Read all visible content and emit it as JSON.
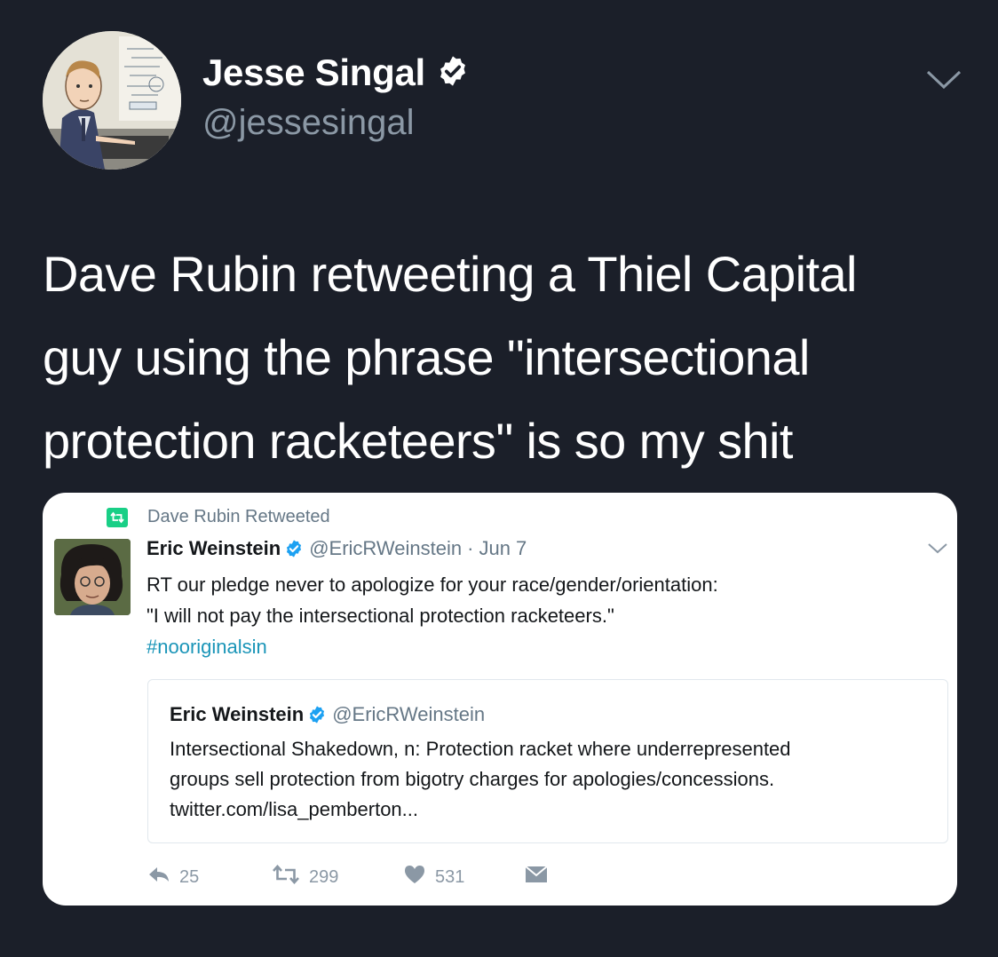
{
  "header": {
    "name": "Jesse Singal",
    "handle": "@jessesingal",
    "avatar_icon": "cartoon-avatar",
    "verified_icon": "verified-badge-icon",
    "menu_icon": "chevron-down-icon"
  },
  "tweet": {
    "lines": [
      "Dave Rubin retweeting a Thiel Capital",
      "guy using the phrase \"intersectional",
      "protection racketeers\" is so my shit"
    ]
  },
  "embedded": {
    "retweeted_by": "Dave Rubin Retweeted",
    "name": "Eric Weinstein",
    "handle": "@EricRWeinstein",
    "separator": "·",
    "date": "Jun 7",
    "body_lines": [
      "RT our pledge never to apologize for your race/gender/orientation:",
      "\"I will not pay the intersectional protection racketeers.\""
    ],
    "hashtag": "#nooriginalsin",
    "quote": {
      "name": "Eric Weinstein",
      "handle": "@EricRWeinstein",
      "lines": [
        "Intersectional Shakedown, n: Protection racket where underrepresented",
        "groups sell protection from bigotry charges for apologies/concessions.",
        "twitter.com/lisa_pemberton..."
      ]
    },
    "actions": {
      "replies": "25",
      "retweets": "299",
      "likes": "531"
    }
  },
  "colors": {
    "background": "#1b1f29",
    "verified_blue": "#1da1f2",
    "retweet_green": "#19cf86",
    "hashtag": "#1b95b8",
    "muted": "#657786"
  }
}
